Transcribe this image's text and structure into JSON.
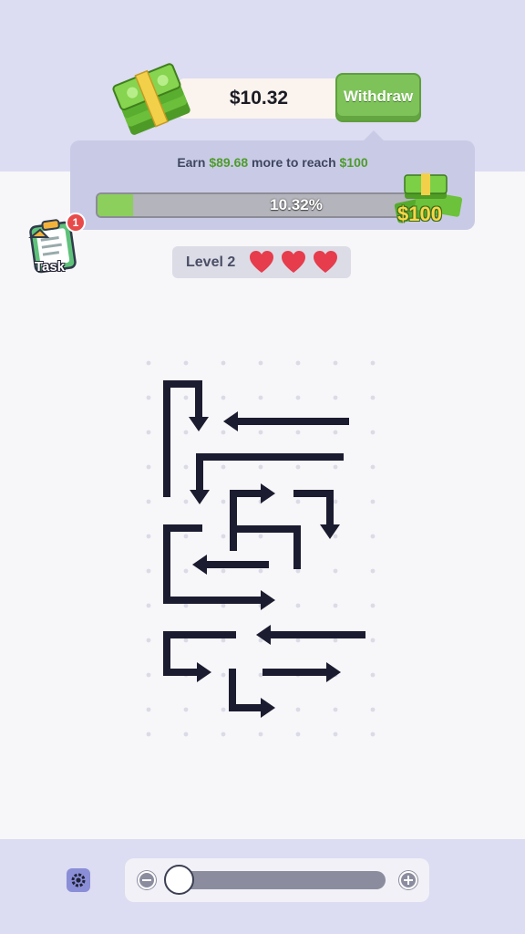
{
  "header": {
    "balance": "$10.32",
    "withdraw_label": "Withdraw"
  },
  "progress": {
    "earn_prefix": "Earn",
    "earn_amount": "$89.68",
    "earn_middle": "more to reach",
    "earn_target": "$100",
    "percent_label": "10.32%",
    "fraction": 0.1032,
    "goal_label": "$100"
  },
  "task": {
    "label": "Task",
    "badge": "1"
  },
  "level": {
    "label": "Level 2",
    "lives": 3
  },
  "bottom": {
    "zoom_level": 0.0
  },
  "colors": {
    "accent_green": "#7ec35a",
    "heart_red": "#e63c4c",
    "arrow": "#1b1c30",
    "panel": "#c9cbe6"
  },
  "icons": [
    "cash-stack-icon",
    "cash-pile-icon",
    "task-clipboard-icon",
    "heart-icon",
    "gear-icon",
    "zoom-out-icon",
    "zoom-in-icon"
  ]
}
